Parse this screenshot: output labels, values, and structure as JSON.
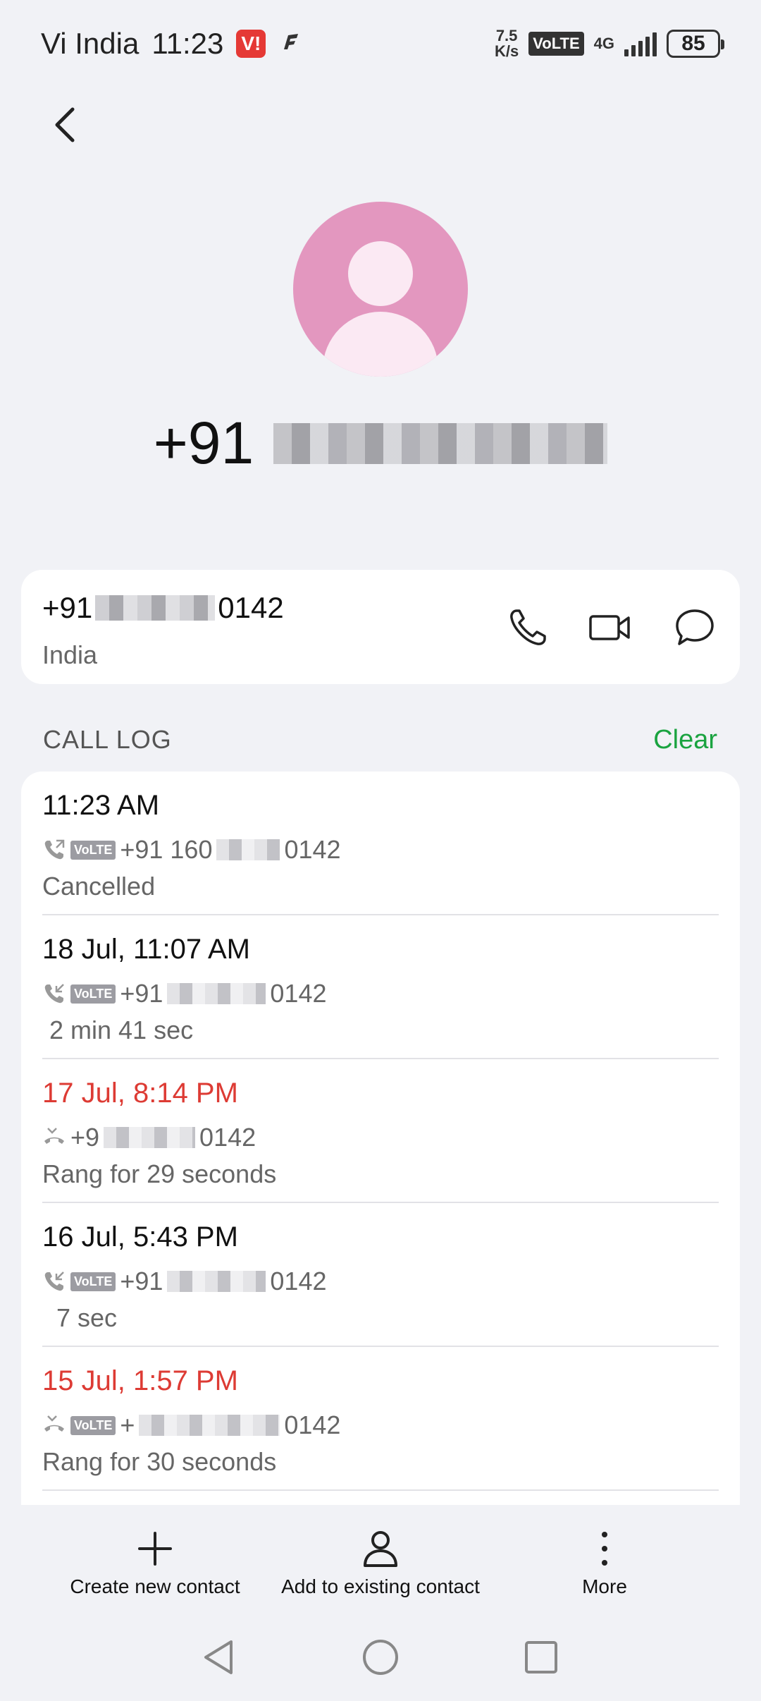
{
  "status_bar": {
    "carrier": "Vi India",
    "time": "11:23",
    "carrier_badge": "V!",
    "net_speed_value": "7.5",
    "net_speed_unit": "K/s",
    "volte": "VoLTE",
    "network": "4G",
    "battery": "85"
  },
  "contact": {
    "title_prefix": "+91",
    "avatar_color": "#e397bf"
  },
  "number_card": {
    "number_prefix": "+91",
    "number_suffix": "0142",
    "country": "India"
  },
  "call_log": {
    "header": "CALL LOG",
    "clear_label": "Clear",
    "entries": [
      {
        "time": "11:23 AM",
        "missed": false,
        "number_prefix": "+91 160",
        "number_suffix": "0142",
        "volte": "VoLTE",
        "detail": "Cancelled"
      },
      {
        "time": "18 Jul, 11:07 AM",
        "missed": false,
        "number_prefix": "+91",
        "number_suffix": "0142",
        "volte": "VoLTE",
        "detail": " 2 min 41 sec"
      },
      {
        "time": "17 Jul, 8:14 PM",
        "missed": true,
        "number_prefix": "+9",
        "number_suffix": "0142",
        "volte": "",
        "detail": "Rang for 29 seconds"
      },
      {
        "time": "16 Jul, 5:43 PM",
        "missed": false,
        "number_prefix": "+91",
        "number_suffix": "0142",
        "volte": "VoLTE",
        "detail": "  7 sec"
      },
      {
        "time": "15 Jul, 1:57 PM",
        "missed": true,
        "number_prefix": "+",
        "number_suffix": "0142",
        "volte": "VoLTE",
        "detail": "Rang for 30 seconds"
      }
    ]
  },
  "bottom_actions": {
    "create_label": "Create new contact",
    "add_existing_label": "Add to existing contact",
    "more_label": "More"
  },
  "colors": {
    "missed": "#dd3b34",
    "clear": "#1aa340"
  }
}
